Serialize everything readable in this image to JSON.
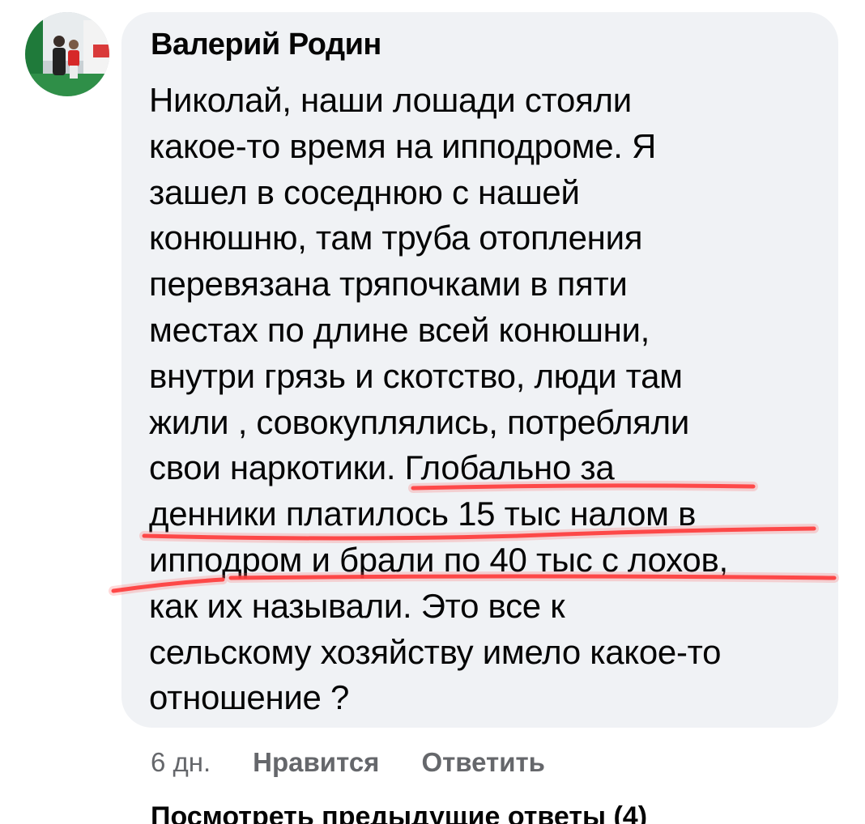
{
  "comment": {
    "author": "Валерий Родин",
    "text": "Николай, наши лошади стояли\nкакое-то время на ипподроме. Я\nзашел в соседнюю с нашей\nконюшню, там труба отопления\nперевязана тряпочками в пяти\nместах по длине всей конюшни,\nвнутри грязь и скотство, люди там\nжили , совокуплялись, потребляли\nсвои наркотики. Глобально за\nденники платилось 15 тыс налом в\nипподром и брали по 40 тыс с лохов,\nкак их называли.  Это все к\nсельскому хозяйству имело какое-то\nотношение ?",
    "time": "6 дн.",
    "like_label": "Нравится",
    "reply_label": "Ответить"
  },
  "view_previous_replies": "Посмотреть предыдущие ответы (4)",
  "colors": {
    "bubble": "#f0f2f5",
    "text": "#050505",
    "meta": "#65676b",
    "underline_marker": "#ff2a2a"
  },
  "icons": {
    "avatar": "user-photo-avatar"
  }
}
